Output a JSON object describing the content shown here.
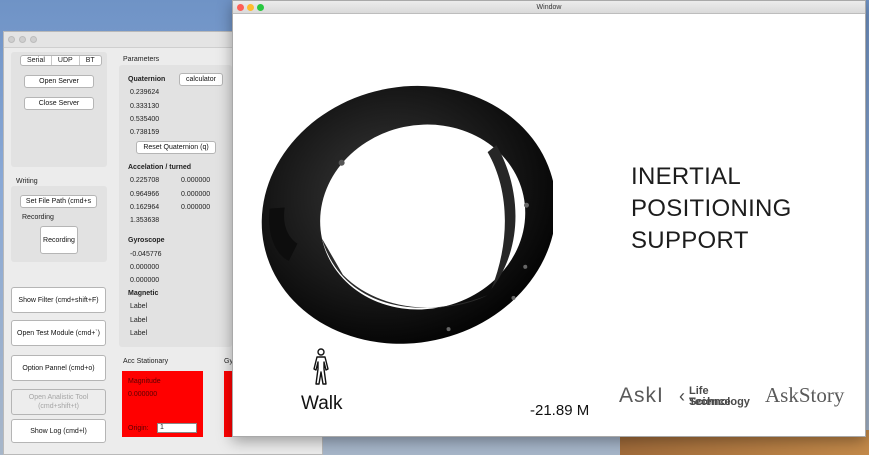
{
  "back_window": {
    "tabs": [
      "Serial",
      "UDP",
      "BT"
    ],
    "open_server": "Open Server",
    "close_server": "Close Server",
    "writing_label": "Writing",
    "set_file_path": "Set File Path (cmd+s",
    "recording_label": "Recording",
    "recording_button": "Recording",
    "show_filter": "Show Filter (cmd+shift+F)",
    "open_test_module": "Open Test Module (cmd+`)",
    "option_panel": "Option Pannel (cmd+o)",
    "open_analistic_tool": "Open Analistic Tool\n(cmd+shift+t)",
    "show_log": "Show Log (cmd+l)",
    "parameters_label": "Parameters",
    "quaternion_label": "Quaternion",
    "calculator_button": "calculator",
    "quaternion_values": [
      "0.239624",
      "0.333130",
      "0.535400",
      "0.738159"
    ],
    "reset_quaternion": "Reset Quaternion (q)",
    "accel_label": "Accelation / turned",
    "accel_values": [
      "0.225708",
      "0.964966",
      "0.162964",
      "1.353638"
    ],
    "turned_values": [
      "0.000000",
      "0.000000",
      "0.000000"
    ],
    "gyro_label": "Gyroscope",
    "gyro_values": [
      "-0.045776",
      "0.000000",
      "0.000000"
    ],
    "magnetic_label": "Magnetic",
    "magnetic_values": [
      "Label",
      "Label",
      "Label"
    ],
    "acc_stationary_label": "Acc Stationary",
    "gy_label": "Gy",
    "magnitude_label": "Magnitude",
    "magnitude_value": "0.000000",
    "origin_label": "Origin:",
    "origin_value": "1"
  },
  "front_window": {
    "title": "Window",
    "headline_lines": [
      "INERTIAL",
      "POSITIONING",
      "SUPPORT"
    ],
    "activity_label": "Walk",
    "distance": "-21.89 M",
    "logos": [
      "AskI",
      "Life Science",
      "Technology",
      "AskStory"
    ]
  },
  "colors": {
    "alert_red": "#ff0000",
    "mac_close": "#fe5f57",
    "mac_min": "#febc2e",
    "mac_max": "#28c840"
  }
}
